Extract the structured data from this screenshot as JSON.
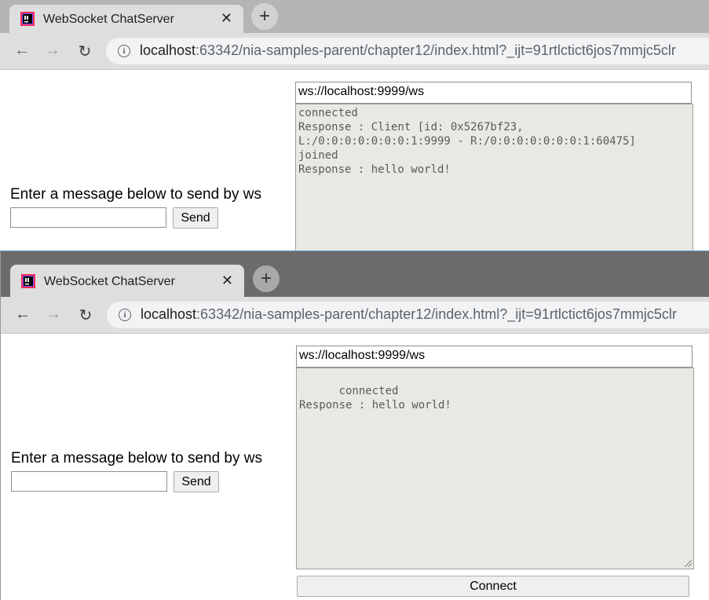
{
  "browser": {
    "tab_title": "WebSocket ChatServer",
    "close_glyph": "✕",
    "new_tab_glyph": "+",
    "url_host": "localhost",
    "url_rest": ":63342/nia-samples-parent/chapter12/index.html?_ijt=91rtlctict6jos7mmjc5clr",
    "info_glyph": "i",
    "back_glyph": "←",
    "forward_glyph": "→",
    "reload_glyph": "↻"
  },
  "window1": {
    "prompt_label": "Enter a message below to send by ws",
    "message_value": "",
    "send_label": "Send",
    "ws_url": "ws://localhost:9999/ws",
    "log": "connected\nResponse : Client [id: 0x5267bf23,\nL:/0:0:0:0:0:0:0:1:9999 - R:/0:0:0:0:0:0:0:1:60475]\njoined\nResponse : hello world!"
  },
  "window2": {
    "prompt_label": "Enter a message below to send by ws",
    "message_value": "",
    "send_label": "Send",
    "ws_url": "ws://localhost:9999/ws",
    "log": "connected\nResponse : hello world!",
    "connect_label": "Connect"
  },
  "colors": {
    "accent_border": "#5d9cc9",
    "log_background": "#e9e9e3"
  },
  "icons": [
    "intellij-logo-icon",
    "close-icon",
    "new-tab-icon",
    "back-icon",
    "forward-icon",
    "reload-icon",
    "info-icon",
    "resize-grip-icon"
  ]
}
